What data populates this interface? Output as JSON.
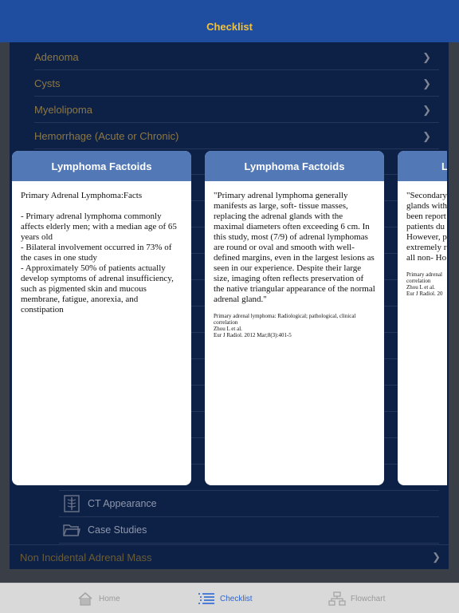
{
  "navbar": {
    "title": "Checklist"
  },
  "list_items": [
    {
      "label": "Adenoma"
    },
    {
      "label": "Cysts"
    },
    {
      "label": "Myelolipoma"
    },
    {
      "label": "Hemorrhage (Acute or Chronic)"
    }
  ],
  "sub_items": [
    {
      "label": "CT Appearance",
      "icon": "xray-icon"
    },
    {
      "label": "Case Studies",
      "icon": "folder-icon"
    }
  ],
  "bottom_item": {
    "label": "Non Incidental Adrenal Mass"
  },
  "cards": [
    {
      "title": "Lymphoma Factoids",
      "heading": "Primary Adrenal Lymphoma:Facts",
      "bullets": [
        "- Primary adrenal lymphoma commonly affects elderly men; with a median age of 65 years old",
        "- Bilateral involvement occurred in 73% of the cases in one study",
        "- Approximately 50% of patients actually develop symptoms of adrenal insufficiency, such as pigmented skin and mucous membrane, fatigue, anorexia, and constipation"
      ]
    },
    {
      "title": "Lymphoma Factoids",
      "quote": "\"Primary adrenal lymphoma generally manifests as large, soft- tissue masses, replacing the adrenal glands with the maximal diameters often exceeding 6 cm. In this study, most (7/9) of adrenal lymphomas are round or oval and smooth with well-defined margins, even in the largest lesions as seen in our experience. Despite their large size, imaging often reflects preservation of the native triangular appearance of the normal adrenal gland.\"",
      "ref_title": "Primary adrenal lymphoma: Radiological; pathological, clinical correlation",
      "ref_authors": "Zhou L et al.",
      "ref_journal": "Eur J Radiol. 2012 Mar;8(3):401-5"
    },
    {
      "title": "L",
      "lines": [
        "\"Secondary",
        "glands with",
        "been report",
        "patients du",
        "However, p",
        "extremely r",
        "all non- Ho"
      ],
      "ref_lines": [
        "Primary adrenal",
        "correlation",
        "Zhou L et al.",
        "Eur J Radiol. 20"
      ]
    }
  ],
  "tabbar": {
    "tabs": [
      {
        "label": "Home",
        "icon": "home-icon"
      },
      {
        "label": "Checklist",
        "icon": "list-icon",
        "active": true
      },
      {
        "label": "Flowchart",
        "icon": "flowchart-icon"
      }
    ]
  },
  "colors": {
    "nav": "#1f4ea1",
    "nav_title": "#f2c23b",
    "content_bg": "#0d2147",
    "card_header": "#5278b6",
    "active_tab": "#2c66d6"
  }
}
